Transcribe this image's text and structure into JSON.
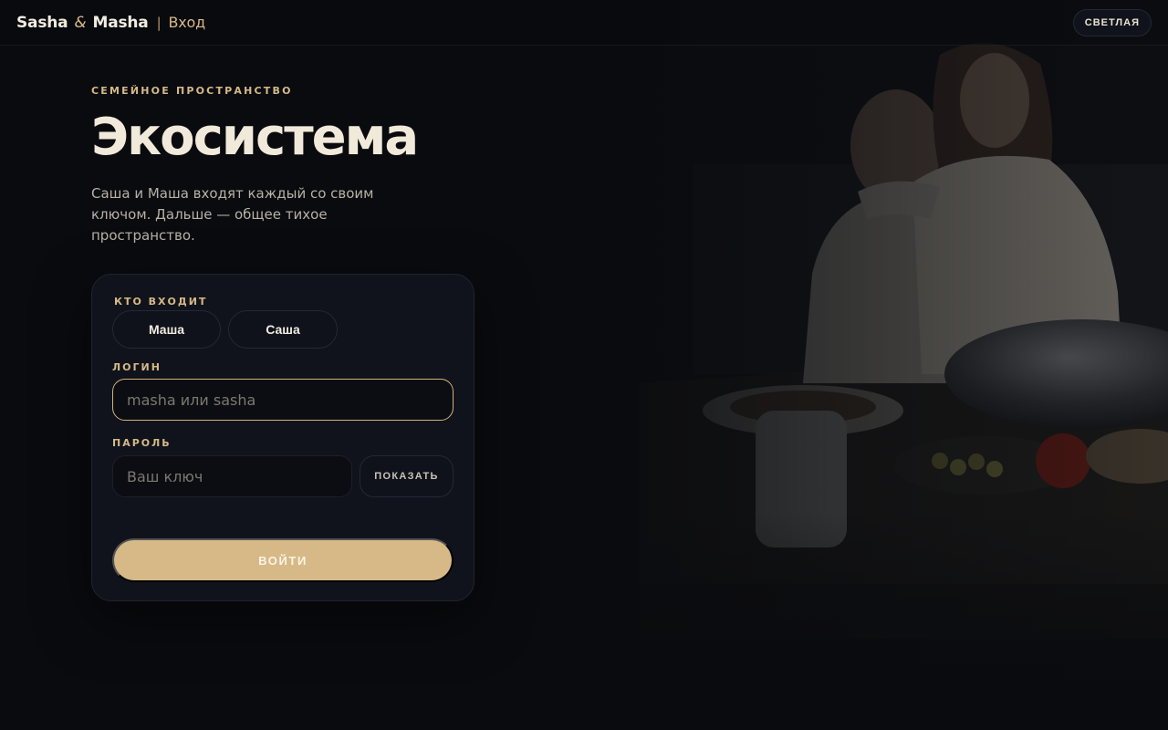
{
  "header": {
    "brand_name_1": "Sasha",
    "brand_ampersand": "&",
    "brand_name_2": "Masha",
    "separator": "|",
    "page_crumb": "Вход",
    "theme_toggle_label": "СВЕТЛАЯ"
  },
  "hero": {
    "eyebrow": "СЕМЕЙНОЕ ПРОСТРАНСТВО",
    "title": "Экосистема",
    "subtitle": "Саша и Маша входят каждый со своим ключом. Дальше — общее тихое пространство."
  },
  "login_form": {
    "who_label": "КТО ВХОДИТ",
    "users": [
      "Маша",
      "Саша"
    ],
    "login_label": "ЛОГИН",
    "login_placeholder": "masha или sasha",
    "password_label": "ПАРОЛЬ",
    "password_placeholder": "Ваш ключ",
    "show_password_label": "ПОКАЗАТЬ",
    "submit_label": "ВОЙТИ"
  },
  "colors": {
    "background": "#0a0b0f",
    "card": "#10131b",
    "accent_gold": "#d6b987",
    "text_primary": "#f1e9da",
    "text_muted": "#b8b1a5"
  },
  "icons": {
    "background_photo": "couple-dinner-photo"
  }
}
